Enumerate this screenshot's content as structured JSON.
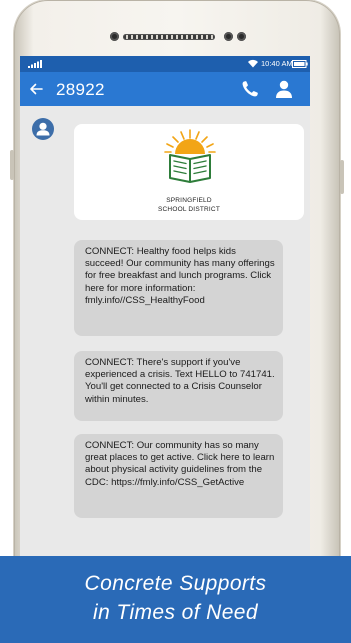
{
  "status_bar": {
    "time": "10:40 AM",
    "icons": [
      "signal-icon",
      "wifi-icon",
      "battery-icon"
    ]
  },
  "app_bar": {
    "contact_number": "28922",
    "icons": [
      "back-arrow-icon",
      "phone-icon",
      "person-icon"
    ]
  },
  "conversation": {
    "avatar_icon": "person-icon",
    "logo": {
      "icon": "open-book-sunrise-icon",
      "line1": "SPRINGFIELD",
      "line2": "SCHOOL DISTRICT"
    },
    "messages": [
      {
        "text": "CONNECT: Healthy food helps kids succeed! Our community has many offerings for free breakfast and lunch programs. Click here for more information: fmly.info//CSS_HealthyFood"
      },
      {
        "text": "CONNECT: There's support if you've experienced a crisis. Text HELLO to 741741. You'll get connected to a Crisis Counselor within minutes."
      },
      {
        "text": "CONNECT: Our community has so many great places to get active. Click here to learn about physical activity guidelines from the CDC: https://fmly.info/CSS_GetActive"
      }
    ]
  },
  "caption": {
    "line1": "Concrete Supports",
    "line2": "in Times of Need"
  },
  "colors": {
    "app_bar": "#2a78d2",
    "status_bar": "#1e5fae",
    "caption_banner": "#2a6ab7",
    "message_bubble": "#d4d4d4",
    "screen_background": "#e9e9e9",
    "logo_sun": "#f2a516",
    "logo_book": "#2e7d3a"
  }
}
